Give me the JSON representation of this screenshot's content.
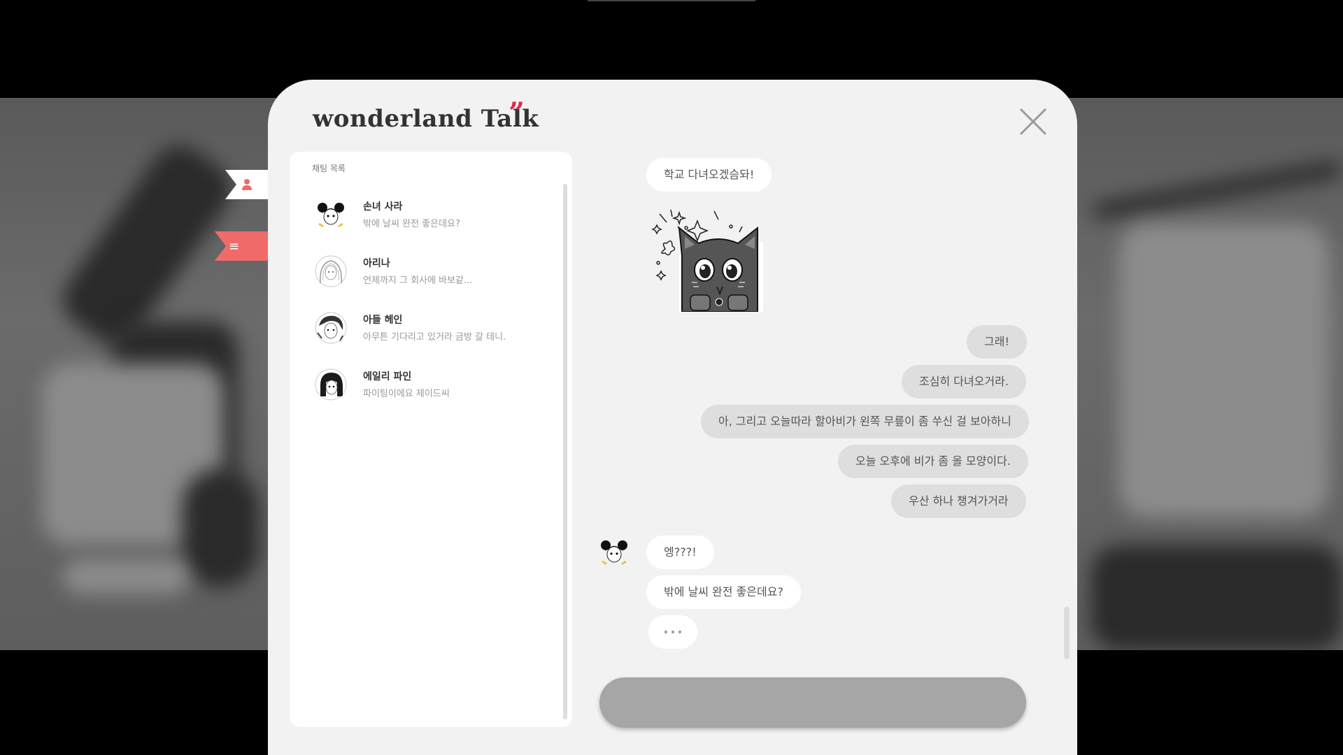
{
  "window": {
    "title": "wonderland Talk",
    "title_mark": "”"
  },
  "side_tabs": {
    "menu_glyph": "≡"
  },
  "chat_list": {
    "heading": "채팅 목록",
    "contacts": [
      {
        "name": "손녀 사라",
        "preview": "밖에 날씨 완전 좋은데요?"
      },
      {
        "name": "아리나",
        "preview": "언제까지 그 회사에 바보같..."
      },
      {
        "name": "아들 헤인",
        "preview": "아무튼 기다리고 있거라 금방 갈 테니."
      },
      {
        "name": "에일리 파인",
        "preview": "파이팅이에요 제이드씨"
      }
    ]
  },
  "messages": {
    "m1": "학교 다녀오겠슴돠!",
    "r1": "그래!",
    "r2": "조심히 다녀오거라.",
    "r3": "아, 그리고 오늘따라 할아비가 왼쪽 무릎이 좀 쑤신 걸 보아하니",
    "r4": "오늘 오후에 비가 좀 올 모양이다.",
    "r5": "우산 하나 챙겨가거라",
    "m2": "엥???!",
    "m3": "밖에 날씨 완전 좋은데요?"
  },
  "colors": {
    "accent": "#e0294a",
    "menu_tab": "#f06a6a",
    "window_bg": "#f2f2f2",
    "input_bar": "#a6a6a6"
  },
  "icons": [
    "person-icon",
    "menu-icon",
    "close-icon",
    "avatar-sara",
    "avatar-arina",
    "avatar-hein",
    "avatar-eily",
    "cat-sticker"
  ]
}
